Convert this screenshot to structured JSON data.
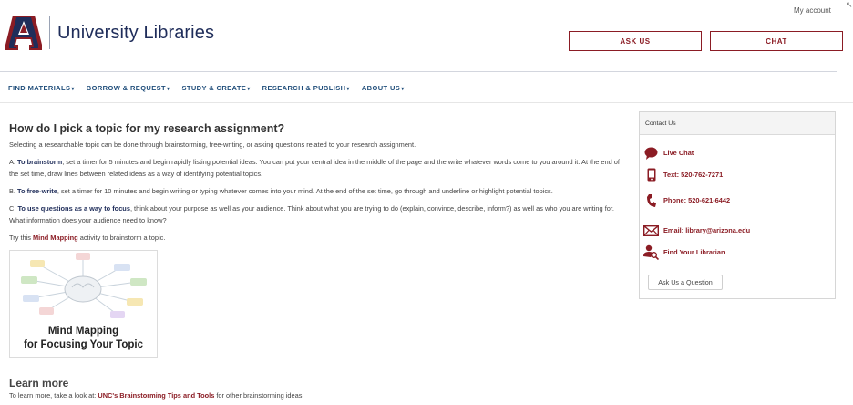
{
  "header": {
    "my_account": "My account",
    "brand": "University Libraries",
    "ask_us": "ASK US",
    "chat": "CHAT",
    "logo_letter": "A"
  },
  "nav": {
    "items": [
      {
        "label": "FIND MATERIALS"
      },
      {
        "label": "BORROW & REQUEST"
      },
      {
        "label": "STUDY & CREATE"
      },
      {
        "label": "RESEARCH & PUBLISH"
      },
      {
        "label": "ABOUT US"
      }
    ],
    "caret": "▾"
  },
  "main": {
    "title": "How do I pick a topic for my research assignment?",
    "intro": "Selecting a researchable topic can be done through brainstorming, free-writing, or asking questions related to your research assignment.",
    "a_label": "To brainstorm",
    "a_prefix": "A. ",
    "a_text": ", set a timer for 5 minutes and begin rapidly listing potential ideas. You can put your central idea in the middle of the page and the write whatever words come to you around it. At the end of the set time, draw lines between related ideas as a way of identifying potential topics.",
    "b_prefix": "B. ",
    "b_label": "To free-write",
    "b_text": ", set a timer for 10 minutes and begin writing or typing whatever comes into your mind. At the end of the set time, go through and underline or highlight potential topics.",
    "c_prefix": "C. ",
    "c_label": "To use questions as a way to focus",
    "c_text": ", think about your purpose as well as your audience. Think about what you are trying to do (explain, convince, describe, inform?) as well as who you are writing for. What information does your audience need to know?",
    "try_prefix": "Try this ",
    "try_link": "Mind Mapping",
    "try_suffix": " activity to brainstorm a topic.",
    "card_line1": "Mind Mapping",
    "card_line2": "for Focusing Your Topic",
    "learn_title": "Learn more",
    "learn_prefix": "To learn more, take a look at: ",
    "learn_link": "UNC's Brainstorming Tips and Tools",
    "learn_suffix": " for other brainstorming ideas."
  },
  "sidebar": {
    "heading": "Contact Us",
    "live_chat": "Live Chat",
    "text": "Text: 520-762-7271",
    "phone": "Phone: 520-621-6442",
    "email": "Email: library@arizona.edu",
    "find": "Find Your Librarian",
    "ask_button": "Ask Us a Question"
  },
  "colors": {
    "navy": "#1f2d5a",
    "cardinal": "#8b1c24",
    "nav_blue": "#1f4d7a"
  },
  "icons": [
    "arizona-logo",
    "chat-bubble-icon",
    "mobile-phone-icon",
    "phone-handset-icon",
    "envelope-icon",
    "person-search-icon",
    "mind-map-illustration"
  ]
}
